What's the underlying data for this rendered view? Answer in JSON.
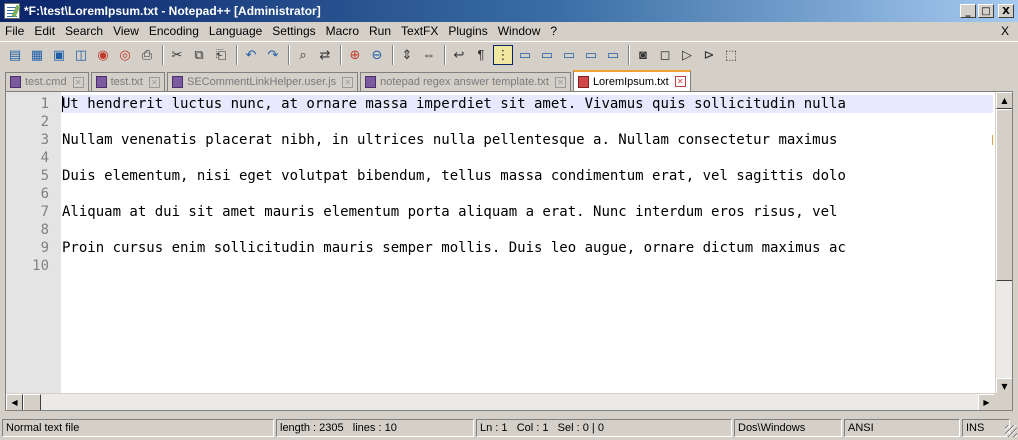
{
  "window": {
    "title": "*F:\\test\\LoremIpsum.txt - Notepad++ [Administrator]",
    "buttons": {
      "minimize": "_",
      "maximize": "□",
      "close": "X"
    }
  },
  "menu": {
    "items": [
      "File",
      "Edit",
      "Search",
      "View",
      "Encoding",
      "Language",
      "Settings",
      "Macro",
      "Run",
      "TextFX",
      "Plugins",
      "Window",
      "?"
    ],
    "close_label": "X"
  },
  "toolbar": {
    "icons": [
      "new-file-icon",
      "open-file-icon",
      "save-icon",
      "save-all-icon",
      "close-icon",
      "close-all-icon",
      "print-icon",
      "cut-icon",
      "copy-icon",
      "paste-icon",
      "undo-icon",
      "redo-icon",
      "find-icon",
      "replace-icon",
      "zoom-in-icon",
      "zoom-out-icon",
      "sync-vertical-icon",
      "sync-horizontal-icon",
      "word-wrap-icon",
      "show-all-chars-icon",
      "indent-guide-icon",
      "user-lang-icon",
      "doc-map-icon",
      "function-list-icon",
      "folder-workspace-icon",
      "monitor-icon",
      "record-macro-icon",
      "stop-macro-icon",
      "play-macro-icon",
      "run-macro-multiple-icon",
      "save-macro-icon"
    ]
  },
  "tabs": [
    {
      "label": "test.cmd",
      "active": false
    },
    {
      "label": "test.txt",
      "active": false
    },
    {
      "label": "SECommentLinkHelper.user.js",
      "active": false
    },
    {
      "label": "notepad regex answer template.txt",
      "active": false
    },
    {
      "label": "LoremIpsum.txt",
      "active": true
    }
  ],
  "editor": {
    "line_numbers": [
      "1",
      "2",
      "3",
      "4",
      "5",
      "6",
      "7",
      "8",
      "9",
      "10"
    ],
    "lines": [
      "Ut hendrerit luctus nunc, at ornare massa imperdiet sit amet. Vivamus quis sollicitudin nulla",
      "",
      "Nullam venenatis placerat nibh, in ultrices nulla pellentesque a. Nullam consectetur maximus ",
      "",
      "Duis elementum, nisi eget volutpat bibendum, tellus massa condimentum erat, vel sagittis dolo",
      "",
      "Aliquam at dui sit amet mauris elementum porta aliquam a erat. Nunc interdum eros risus, vel ",
      "",
      "Proin cursus enim sollicitudin mauris semper mollis. Duis leo augue, ornare dictum maximus ac",
      ""
    ]
  },
  "status": {
    "file_type": "Normal text file",
    "length": "length : 2305",
    "lines": "lines : 10",
    "ln": "Ln : 1",
    "col": "Col : 1",
    "sel": "Sel : 0 | 0",
    "eol": "Dos\\Windows",
    "encoding": "ANSI",
    "mode": "INS"
  }
}
